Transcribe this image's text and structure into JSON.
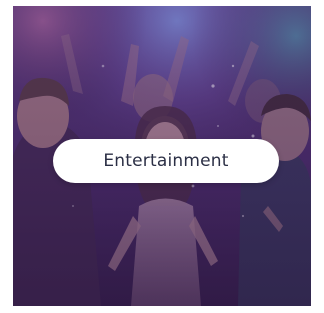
{
  "card": {
    "label": "Entertainment"
  },
  "colors": {
    "overlay": "#3a2550",
    "pill_background": "#ffffff",
    "pill_text": "#2b2f45"
  }
}
